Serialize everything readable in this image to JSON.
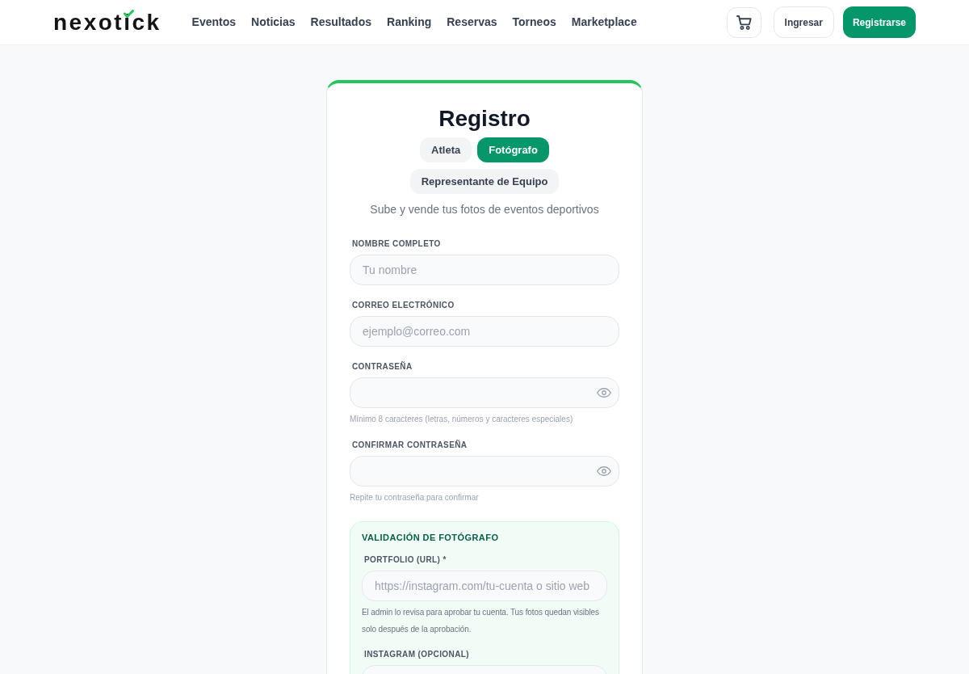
{
  "header": {
    "logo": "nexotick",
    "nav": [
      "Eventos",
      "Noticias",
      "Resultados",
      "Ranking",
      "Reservas",
      "Torneos",
      "Marketplace"
    ],
    "login_button": "Ingresar",
    "register_button": "Registrarse"
  },
  "form": {
    "title": "Registro",
    "role_tabs": [
      {
        "label": "Atleta",
        "selected": false
      },
      {
        "label": "Fotógrafo",
        "selected": true
      },
      {
        "label": "Representante de Equipo",
        "selected": false
      }
    ],
    "subtitle": "Sube y vende tus fotos de eventos deportivos",
    "fields": [
      {
        "kind": "text",
        "label": "NOMBRE COMPLETO",
        "placeholder": "Tu nombre"
      },
      {
        "kind": "text",
        "label": "CORREO ELECTRÓNICO",
        "placeholder": "ejemplo@correo.com"
      },
      {
        "kind": "password",
        "label": "CONTRASEÑA",
        "hint": "Mínimo 8 caracteres (letras, números y caracteres especiales)"
      },
      {
        "kind": "password",
        "label": "CONFIRMAR CONTRASEÑA",
        "hint": "Repite tu contraseña para confirmar"
      }
    ],
    "validation": {
      "title": "VALIDACIÓN DE FOTÓGRAFO",
      "fields": [
        {
          "kind": "text",
          "label": "PORTFOLIO (URL) *",
          "placeholder": "https://instagram.com/tu-cuenta o sitio web",
          "hint": "El admin lo revisa para aprobar tu cuenta. Tus fotos quedan visibles solo después de la aprobación."
        },
        {
          "kind": "text",
          "label": "INSTAGRAM (OPCIONAL)"
        }
      ]
    }
  }
}
